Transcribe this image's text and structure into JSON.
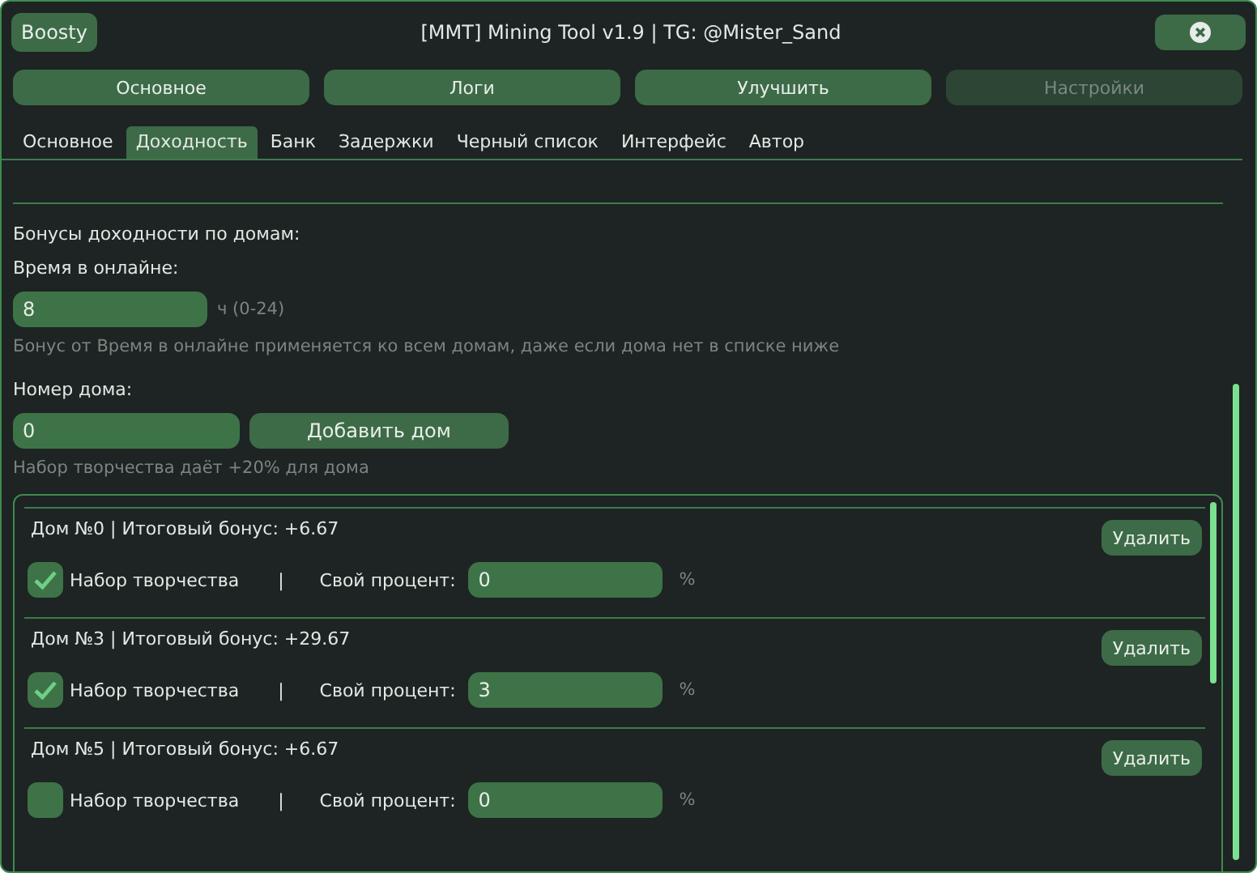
{
  "window": {
    "title": "[MMT] Mining Tool v1.9 | TG: @Mister_Sand",
    "boosty_button": "Boosty"
  },
  "main_tabs": [
    {
      "label": "Основное",
      "selected": false
    },
    {
      "label": "Логи",
      "selected": false
    },
    {
      "label": "Улучшить",
      "selected": false
    },
    {
      "label": "Настройки",
      "selected": true
    }
  ],
  "sub_tabs": [
    {
      "label": "Основное",
      "selected": false
    },
    {
      "label": "Доходность",
      "selected": true
    },
    {
      "label": "Банк",
      "selected": false
    },
    {
      "label": "Задержки",
      "selected": false
    },
    {
      "label": "Черный список",
      "selected": false
    },
    {
      "label": "Интерфейс",
      "selected": false
    },
    {
      "label": "Автор",
      "selected": false
    }
  ],
  "section_title": "Бонусы доходности по домам:",
  "online": {
    "label": "Время в онлайне:",
    "value": "8",
    "unit": "ч (0-24)",
    "hint": "Бонус от Время в онлайне применяется ко всем домам, даже если дома нет в списке ниже"
  },
  "house_number": {
    "label": "Номер дома:",
    "value": "0",
    "add_button": "Добавить дом",
    "hint": "Набор творчества даёт +20% для дома"
  },
  "houses": [
    {
      "title": "Дом №0 | Итоговый бонус: +6.67",
      "delete": "Удалить",
      "creative_label": "Набор творчества",
      "checked": true,
      "separator": "|",
      "percent_label": "Свой процент:",
      "percent": "0",
      "unit": "%"
    },
    {
      "title": "Дом №3 | Итоговый бонус: +29.67",
      "delete": "Удалить",
      "creative_label": "Набор творчества",
      "checked": true,
      "separator": "|",
      "percent_label": "Свой процент:",
      "percent": "3",
      "unit": "%"
    },
    {
      "title": "Дом №5 | Итоговый бонус: +6.67",
      "delete": "Удалить",
      "creative_label": "Набор творчества",
      "checked": false,
      "separator": "|",
      "percent_label": "Свой процент:",
      "percent": "0",
      "unit": "%"
    }
  ]
}
